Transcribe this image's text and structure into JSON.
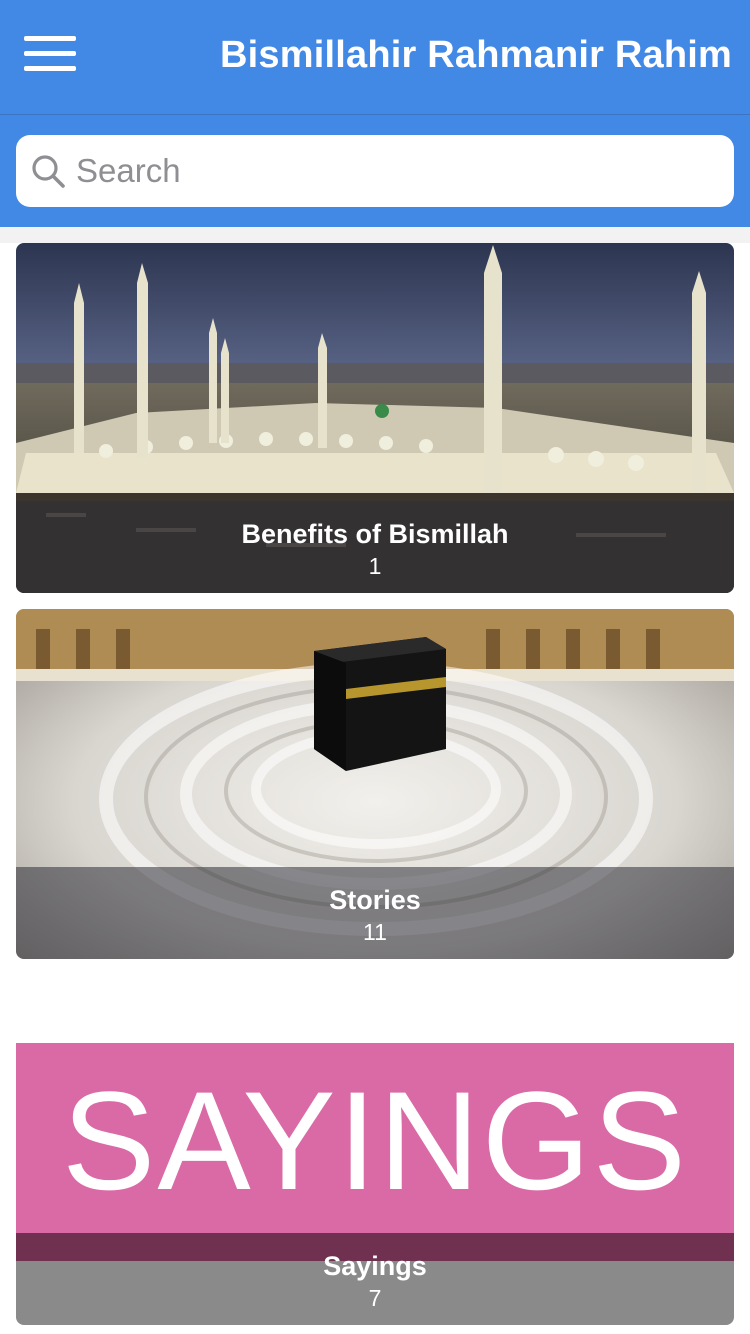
{
  "header": {
    "title": "Bismillahir Rahmanir Rahim",
    "menu_icon": "hamburger-menu-icon"
  },
  "search": {
    "placeholder": "Search",
    "icon": "search-icon"
  },
  "colors": {
    "header_bg": "#4289e6",
    "sayings_pink": "#da6aa6"
  },
  "cards": [
    {
      "title": "Benefits of Bismillah",
      "count": "1",
      "image": "mosque-night-photo"
    },
    {
      "title": "Stories",
      "count": "11",
      "image": "kaaba-tawaf-photo"
    },
    {
      "title": "Sayings",
      "count": "7",
      "image": "sayings-banner",
      "banner_text": "SAYINGS"
    }
  ]
}
